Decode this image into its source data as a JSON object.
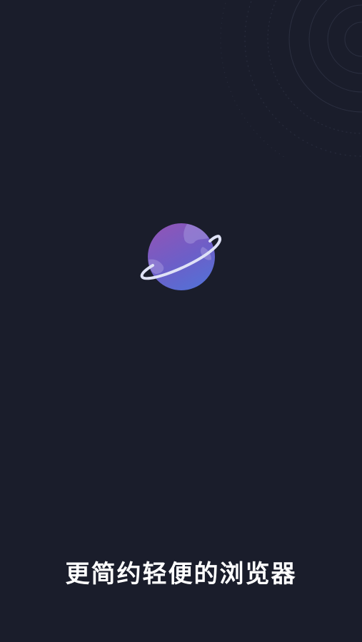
{
  "splash": {
    "slogan": "更简约轻便的浏览器",
    "logo_icon": "planet-icon",
    "decoration_icon": "concentric-rings",
    "colors": {
      "background": "#1a1d2b",
      "planet_top": "#8e55b8",
      "planet_bottom": "#5470d6",
      "ring": "#dfe2f6",
      "slogan_text": "#ffffff"
    }
  }
}
